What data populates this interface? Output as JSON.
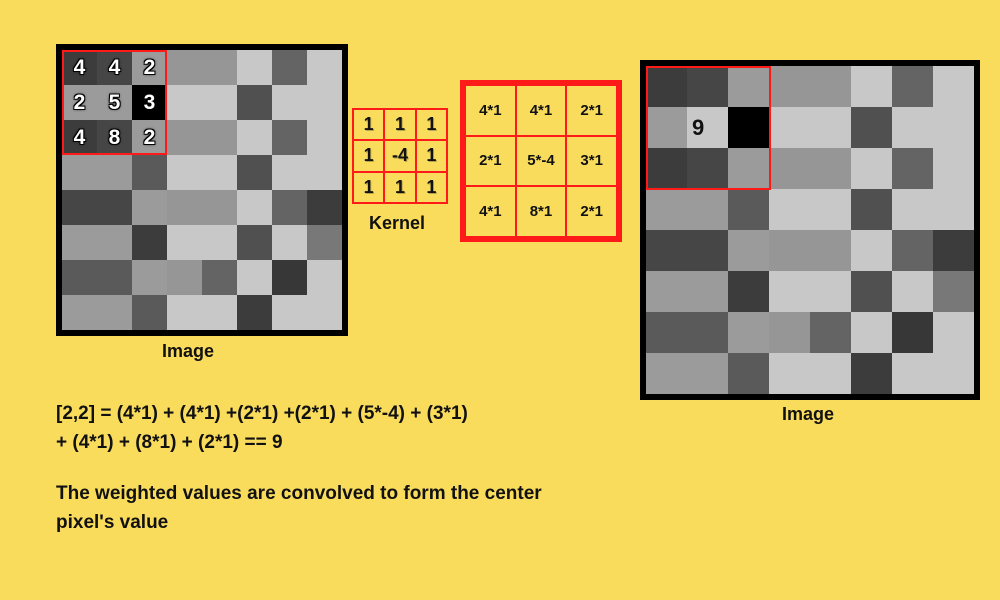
{
  "source_image": {
    "label": "Image",
    "grid": [
      [
        60,
        70,
        155,
        150,
        150,
        200,
        100,
        200
      ],
      [
        155,
        155,
        0,
        200,
        200,
        80,
        200,
        200
      ],
      [
        60,
        70,
        155,
        150,
        150,
        200,
        100,
        200
      ],
      [
        155,
        155,
        90,
        200,
        200,
        80,
        200,
        200
      ],
      [
        70,
        70,
        155,
        150,
        150,
        200,
        100,
        60
      ],
      [
        155,
        155,
        60,
        200,
        200,
        80,
        200,
        120
      ],
      [
        90,
        90,
        155,
        150,
        100,
        200,
        55,
        200
      ],
      [
        155,
        155,
        90,
        200,
        200,
        60,
        200,
        200
      ]
    ],
    "highlight_window": {
      "rows": [
        0,
        2
      ],
      "cols": [
        0,
        2
      ],
      "values": [
        [
          4,
          4,
          2
        ],
        [
          2,
          5,
          3
        ],
        [
          4,
          8,
          2
        ]
      ]
    }
  },
  "kernel": {
    "label": "Kernel",
    "values": [
      [
        1,
        1,
        1
      ],
      [
        1,
        -4,
        1
      ],
      [
        1,
        1,
        1
      ]
    ]
  },
  "calculation": {
    "cells": [
      [
        "4*1",
        "4*1",
        "2*1"
      ],
      [
        "2*1",
        "5*-4",
        "3*1"
      ],
      [
        "4*1",
        "8*1",
        "2*1"
      ]
    ]
  },
  "result_image": {
    "label": "Image",
    "grid": [
      [
        60,
        70,
        155,
        150,
        150,
        200,
        100,
        200
      ],
      [
        155,
        200,
        0,
        200,
        200,
        80,
        200,
        200
      ],
      [
        60,
        70,
        155,
        150,
        150,
        200,
        100,
        200
      ],
      [
        155,
        155,
        90,
        200,
        200,
        80,
        200,
        200
      ],
      [
        70,
        70,
        155,
        150,
        150,
        200,
        100,
        60
      ],
      [
        155,
        155,
        60,
        200,
        200,
        80,
        200,
        120
      ],
      [
        90,
        90,
        155,
        150,
        100,
        200,
        55,
        200
      ],
      [
        155,
        155,
        90,
        200,
        200,
        60,
        200,
        200
      ]
    ],
    "highlight_window": {
      "rows": [
        0,
        2
      ],
      "cols": [
        0,
        2
      ],
      "center_value": 9
    }
  },
  "equation_line1": "[2,2] = (4*1) + (4*1) +(2*1) +(2*1) + (5*-4) + (3*1)",
  "equation_line2": "+ (4*1) + (8*1) + (2*1) == 9",
  "explanation": "The weighted values are convolved to form the center pixel's value"
}
